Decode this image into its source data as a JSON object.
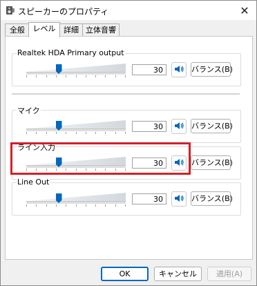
{
  "window": {
    "title": "スピーカーのプロパティ",
    "close_label": "✕"
  },
  "tabs": [
    {
      "label": "全般"
    },
    {
      "label": "レベル",
      "active": true
    },
    {
      "label": "詳細"
    },
    {
      "label": "立体音響"
    }
  ],
  "devices": [
    {
      "label": "Realtek HDA Primary output",
      "volume": "30",
      "level": 0.3,
      "balance_label": "バランス(B)"
    },
    {
      "label": "マイク",
      "volume": "30",
      "level": 0.3,
      "balance_label": "バランス(B)"
    },
    {
      "label": "ライン入力",
      "volume": "30",
      "level": 0.3,
      "balance_label": "バランス(B)"
    },
    {
      "label": "Line Out",
      "volume": "30",
      "level": 0.3,
      "balance_label": "バランス(B)"
    }
  ],
  "highlighted_device": "ライン入力",
  "highlight_color": "#d32027",
  "accent_color": "#0067c0",
  "icons": {
    "app": "speaker-properties-icon",
    "speaker": "speaker-icon",
    "close": "close-icon"
  },
  "buttons": {
    "ok": "OK",
    "cancel": "キャンセル",
    "apply": "適用(A)"
  }
}
